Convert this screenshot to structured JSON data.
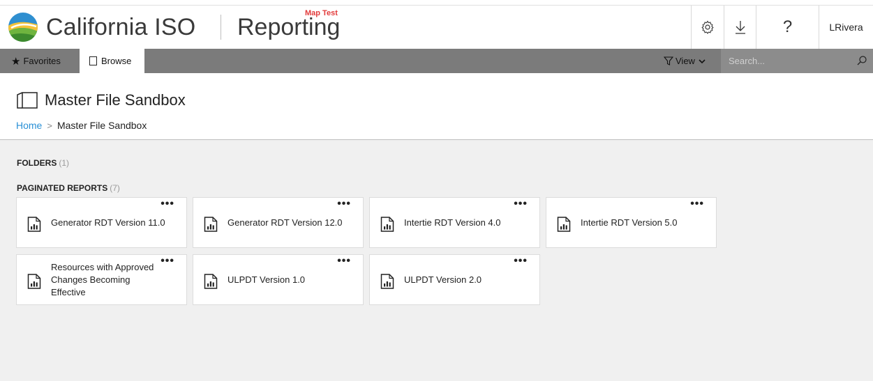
{
  "header": {
    "brand": "California ISO",
    "product": "Reporting",
    "environment_label": "Map Test",
    "user": "LRivera",
    "help_label": "?"
  },
  "navbar": {
    "favorites_label": "Favorites",
    "browse_label": "Browse",
    "view_label": "View",
    "search_placeholder": "Search..."
  },
  "page": {
    "title": "Master File Sandbox",
    "breadcrumb": {
      "home": "Home",
      "separator": ">",
      "current": "Master File Sandbox"
    }
  },
  "sections": {
    "folders": {
      "label": "FOLDERS",
      "count": "(1)"
    },
    "reports": {
      "label": "PAGINATED REPORTS",
      "count": "(7)"
    }
  },
  "reports": [
    {
      "name": "Generator RDT Version 11.0"
    },
    {
      "name": "Generator RDT Version 12.0"
    },
    {
      "name": "Intertie RDT Version 4.0"
    },
    {
      "name": "Intertie RDT Version 5.0"
    },
    {
      "name": "Resources with Approved Changes Becoming Effective"
    },
    {
      "name": "ULPDT Version 1.0"
    },
    {
      "name": "ULPDT Version 2.0"
    }
  ],
  "tile_menu_label": "•••",
  "icons": {
    "logo": "california-iso-globe-icon",
    "settings": "gear-icon",
    "download": "download-icon",
    "help": "help-icon",
    "favorites": "star-icon",
    "browse": "page-icon",
    "view": "filter-icon",
    "search": "search-icon",
    "folder": "folder-open-icon",
    "report": "report-icon"
  },
  "colors": {
    "navbar": "#7b7b7b",
    "search_bg": "#8c8c8c",
    "content_bg": "#f0f0f0",
    "link": "#2a90d6",
    "environment_label": "#e23b3b"
  }
}
